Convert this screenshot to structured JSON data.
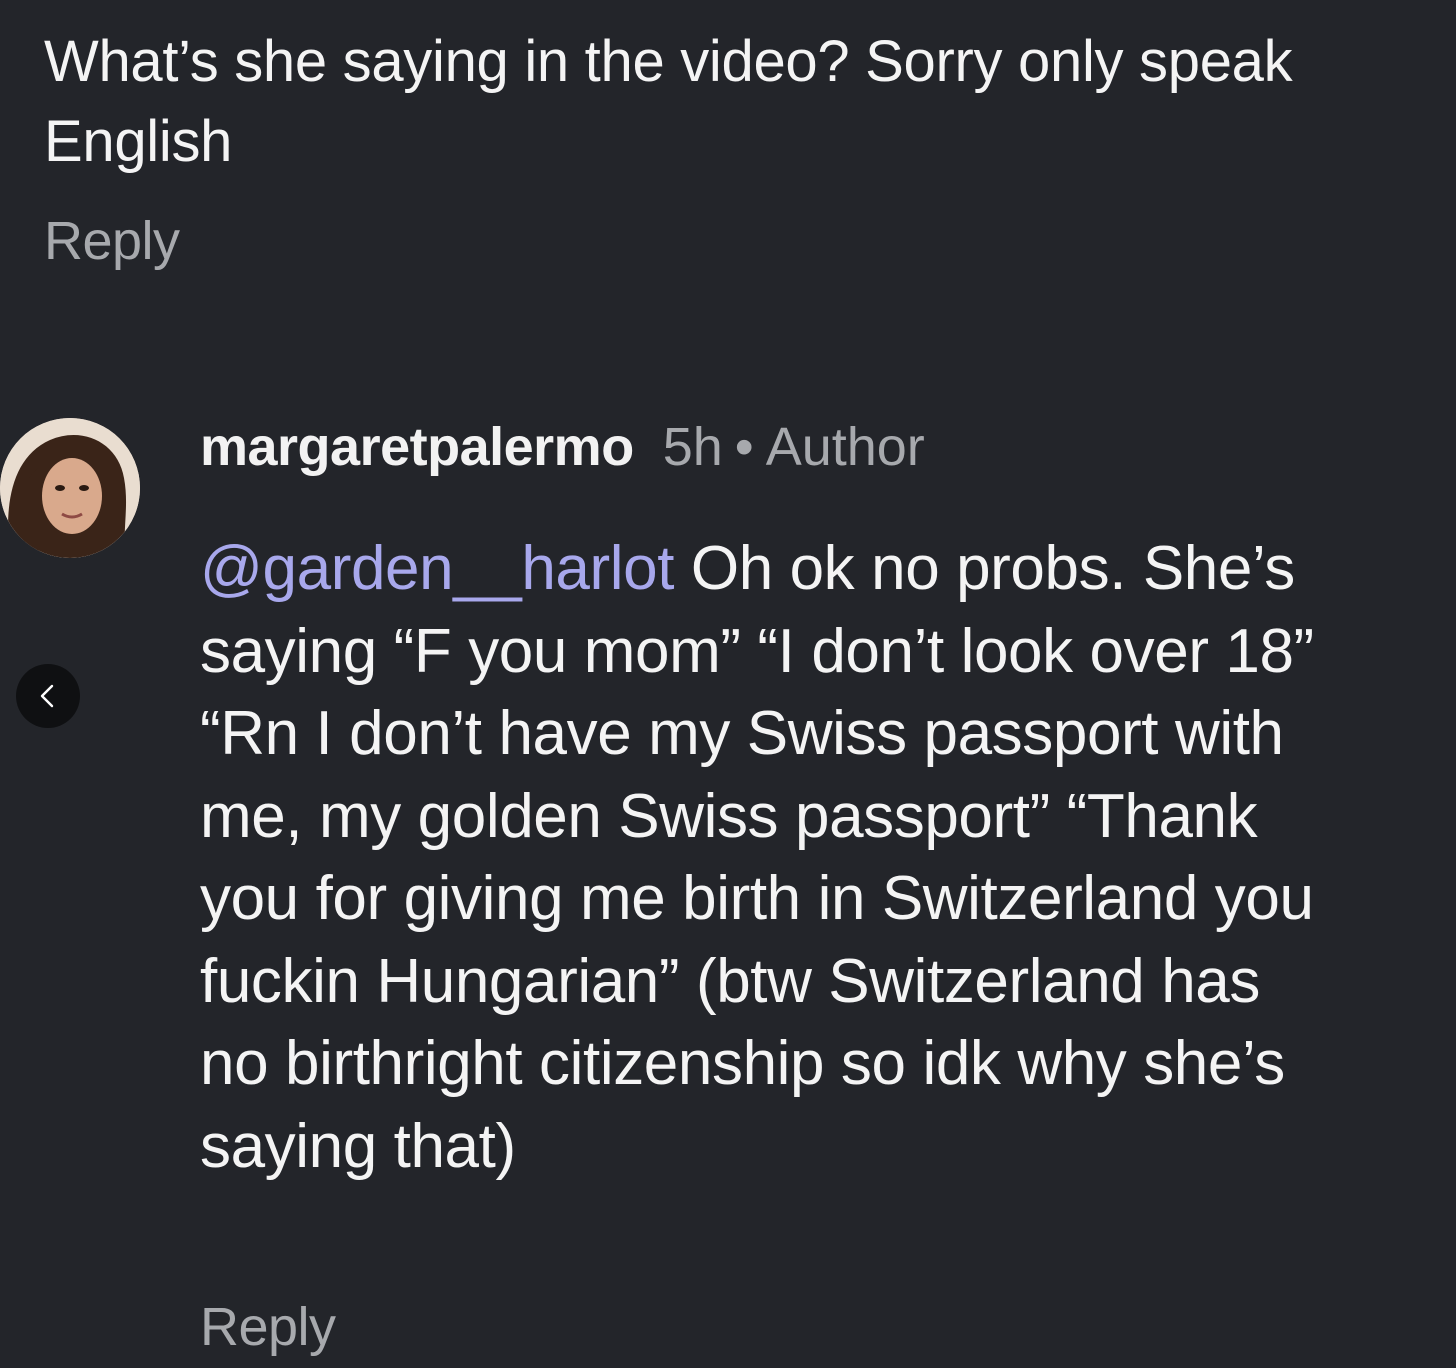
{
  "parent_comment": {
    "text": "What’s she saying in the video? Sorry only speak English",
    "reply_label": "Reply"
  },
  "reply_comment": {
    "username": "margaretpalermo",
    "time": "5h",
    "separator": "•",
    "badge": "Author",
    "mention": "@garden__harlot",
    "text": " Oh ok no probs. She’s saying “F you mom” “I don’t look over 18” “Rn I don’t have my Swiss passport with me, my golden Swiss passport” “Thank you for giving me birth in Switzerland you fuckin Hungarian” (btw Switzerland has no birthright citizenship so idk why she’s saying that)",
    "reply_label": "Reply",
    "avatar_icon": "user-avatar"
  },
  "navigation": {
    "back_icon": "chevron-left-icon"
  },
  "colors": {
    "background": "#23252a",
    "text": "#f4f4f4",
    "muted": "#a7a9ad",
    "mention": "#a8a8ec"
  }
}
